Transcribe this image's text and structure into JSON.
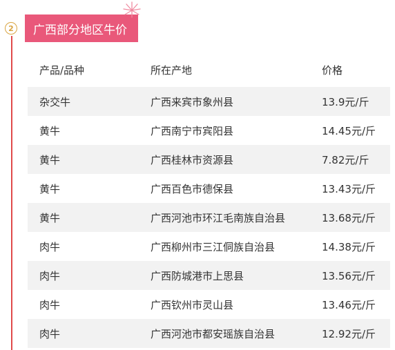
{
  "section": {
    "number": "2",
    "title": "广西部分地区牛价",
    "accent": "#e9587a",
    "rail_color": "#e04a4a"
  },
  "table": {
    "headers": [
      "产品/品种",
      "所在产地",
      "价格"
    ],
    "rows": [
      [
        "杂交牛",
        "广西来宾市象州县",
        "13.9元/斤"
      ],
      [
        "黄牛",
        "广西南宁市宾阳县",
        "14.45元/斤"
      ],
      [
        "黄牛",
        "广西桂林市资源县",
        "7.82元/斤"
      ],
      [
        "黄牛",
        "广西百色市德保县",
        "13.43元/斤"
      ],
      [
        "黄牛",
        "广西河池市环江毛南族自治县",
        "13.68元/斤"
      ],
      [
        "肉牛",
        "广西柳州市三江侗族自治县",
        "14.38元/斤"
      ],
      [
        "肉牛",
        "广西防城港市上思县",
        "13.56元/斤"
      ],
      [
        "肉牛",
        "广西钦州市灵山县",
        "13.46元/斤"
      ],
      [
        "肉牛",
        "广西河池市都安瑶族自治县",
        "12.92元/斤"
      ]
    ]
  }
}
